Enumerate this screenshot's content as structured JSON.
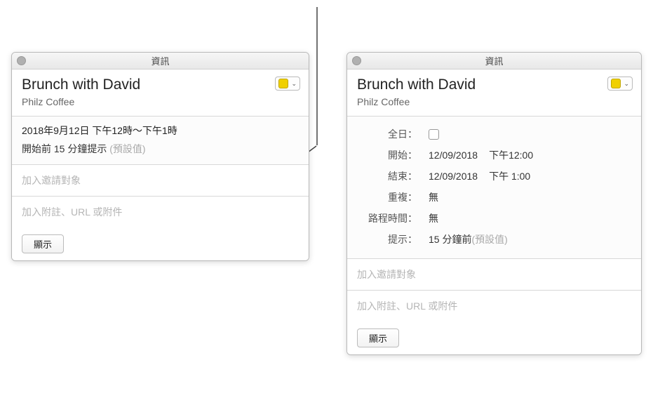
{
  "left": {
    "title": "資訊",
    "event_title": "Brunch with David",
    "location": "Philz Coffee",
    "datetime": "2018年9月12日  下午12時～下午1時",
    "alarm_prefix": "開始前 15 分鐘提示 ",
    "alarm_default": "(預設值)",
    "invitees_placeholder": "加入邀請對象",
    "notes_placeholder": "加入附註、URL 或附件",
    "show": "顯示"
  },
  "right": {
    "title": "資訊",
    "event_title": "Brunch with David",
    "location": "Philz Coffee",
    "labels": {
      "all_day": "全日：",
      "start": "開始：",
      "end": "結束：",
      "repeat": "重複：",
      "travel": "路程時間：",
      "alert": "提示："
    },
    "start_date": "12/09/2018",
    "start_time": "下午12:00",
    "end_date": "12/09/2018",
    "end_time": "下午  1:00",
    "repeat_value": "無",
    "travel_value": "無",
    "alert_value": "15 分鐘前 ",
    "alert_default": "(預設值)",
    "invitees_placeholder": "加入邀請對象",
    "notes_placeholder": "加入附註、URL 或附件",
    "show": "顯示"
  }
}
